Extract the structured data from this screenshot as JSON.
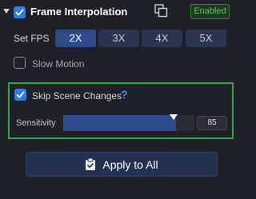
{
  "header": {
    "title": "Frame Interpolation",
    "enabled_checked": true,
    "status_badge": "Enabled",
    "badge_color": "#5fc45a"
  },
  "fps": {
    "label": "Set FPS",
    "options": [
      "2X",
      "3X",
      "4X",
      "5X"
    ],
    "selected": "2X"
  },
  "slow_motion": {
    "label": "Slow Motion",
    "checked": false
  },
  "skip_scene": {
    "label": "Skip Scene Changes",
    "help_symbol": "?",
    "checked": true,
    "sensitivity_label": "Sensitivity",
    "sensitivity_value": "85"
  },
  "apply": {
    "label": "Apply to All",
    "icon": "clipboard-check-icon"
  },
  "colors": {
    "accent": "#2f7dea",
    "highlight_box": "#2fa64a",
    "background": "#1f2026"
  }
}
